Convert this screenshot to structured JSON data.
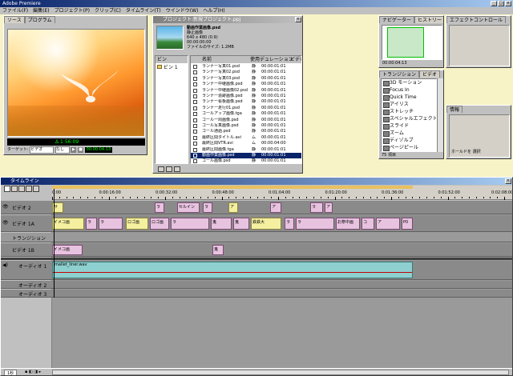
{
  "app": {
    "title": "Adobe Premiere"
  },
  "menu": [
    "ファイル(F)",
    "編集(E)",
    "プロジェクト(P)",
    "クリップ(C)",
    "タイムライン(T)",
    "ウインドウ(W)",
    "ヘルプ(H)"
  ],
  "monitor": {
    "tabs": [
      "ソース",
      "プログラム"
    ],
    "timecode": "Δ 1:56:09",
    "duration": "00:00:04:13",
    "target_label": "ターゲット:",
    "target_value": "ビデオ",
    "none_label": "なし"
  },
  "project": {
    "title": "プロジェクト:新規プロジェクト.ppj",
    "preview": {
      "name": "動画作業画像.psd",
      "type": "静止画像",
      "dims": "640 x 480 (0.9)",
      "duration": "00:00:00:00",
      "size": "ファイルのサイズ: 1.2MB"
    },
    "bin_header": "ビン",
    "bin_name": "ビン 1",
    "columns": [
      "名前",
      "使用",
      "デュレーション",
      "ビデオ"
    ],
    "rows": [
      {
        "name": "ランナー写真01.psd",
        "use": "静",
        "dur": "00:00:01:01"
      },
      {
        "name": "ランナー写真02.psd",
        "use": "静",
        "dur": "00:00:01:01"
      },
      {
        "name": "ランナー写真03.psd",
        "use": "静",
        "dur": "00:00:01:01"
      },
      {
        "name": "ランナー中継画像.psd",
        "use": "静",
        "dur": "00:00:01:01"
      },
      {
        "name": "ランナー中継画像02.psd",
        "use": "静",
        "dur": "00:00:01:01"
      },
      {
        "name": "ランナー追跡画像.psd",
        "use": "静",
        "dur": "00:00:01:01"
      },
      {
        "name": "ランナー看板画像.psd",
        "use": "静",
        "dur": "00:00:01:01"
      },
      {
        "name": "ランナー走行01.psd",
        "use": "静",
        "dur": "00:00:01:01"
      },
      {
        "name": "ゴールアップ画像.tga",
        "use": "静",
        "dur": "00:00:01:01"
      },
      {
        "name": "ゴール一周画像.psd",
        "use": "静",
        "dur": "00:00:01:01"
      },
      {
        "name": "ゴール写真画像.psd",
        "use": "静",
        "dur": "00:00:01:01"
      },
      {
        "name": "ゴール通過.psd",
        "use": "静",
        "dur": "00:00:01:01"
      },
      {
        "name": "最終区間タイトル.avi",
        "use": "ム",
        "dur": "00:00:01:01"
      },
      {
        "name": "最終区間VTR.avi",
        "use": "ム",
        "dur": "00:00:04:00"
      },
      {
        "name": "最終区間画像.tga",
        "use": "静",
        "dur": "00:00:01:01"
      },
      {
        "name": "動画作業画像.psd",
        "use": "静",
        "dur": "00:00:01:01",
        "selected": true
      },
      {
        "name": "ゴール画像.psd",
        "use": "静",
        "dur": "00:00:01:01"
      }
    ]
  },
  "navigator": {
    "tabs": [
      "ナビゲーター",
      "ヒストリー",
      "インフォ"
    ],
    "timecode": "00:00:04:13"
  },
  "commands": {
    "tabs": [
      "エフェクトコントロール"
    ]
  },
  "transitions": {
    "tabs": [
      "トランジション",
      "ビデオ",
      "オーディオ"
    ],
    "items": [
      "3D モーション",
      "Focus In",
      "Quick Time",
      "アイリス",
      "ストレッチ",
      "スペシャルエフェクト",
      "スライド",
      "ズーム",
      "ディゾルブ",
      "ページピール",
      "マップ",
      "ワイプ"
    ],
    "footer": "75 項目"
  },
  "info": {
    "tabs": [
      "情報"
    ],
    "label": "ホールドを 選択"
  },
  "timeline": {
    "title": "タイムライン",
    "ruler": [
      "0:00",
      "0:00:16:00",
      "0:00:32:00",
      "0:00:48:00",
      "0:01:04:00",
      "0:01:20:00",
      "0:01:36:00",
      "0:01:52:00",
      "0:02:08:00"
    ],
    "tracks": {
      "video2": "ビデオ 2",
      "video1a": "ビデオ 1A",
      "transition": "トランジション",
      "video1b": "ビデオ 1B",
      "audio1": "オーディオ 1",
      "audio2": "オーディオ 2",
      "audio3": "オーディオ 3"
    },
    "audio_clip": "mallet_liner.wav",
    "clips_v1a": [
      {
        "label": "イメコ画",
        "yellow": true
      },
      {
        "label": "ラ"
      },
      {
        "label": "ラ"
      },
      {
        "label": "ロゴ画",
        "yellow": true
      },
      {
        "label": "ロゴ画"
      },
      {
        "label": "ラ"
      },
      {
        "label": "鬼"
      },
      {
        "label": "鬼"
      },
      {
        "label": "鉄鉄大",
        "yellow": true
      },
      {
        "label": "ラ"
      },
      {
        "label": "ラ"
      },
      {
        "label": "お祭中画"
      },
      {
        "label": "コ"
      },
      {
        "label": "ア"
      },
      {
        "label": "P0"
      }
    ],
    "clips_v2": [
      {
        "label": "サ",
        "yellow": true
      },
      {
        "label": "ラ"
      },
      {
        "label": "セルイン"
      },
      {
        "label": "ラ"
      },
      {
        "label": "ア",
        "yellow": true
      },
      {
        "label": "ア"
      },
      {
        "label": "ラ"
      },
      {
        "label": "ア"
      }
    ],
    "clips_v1b": [
      {
        "label": "イメコ画"
      },
      {
        "label": "鬼"
      }
    ],
    "footer_left": "1秒",
    "footer_icons": "▪ ◧ ◨ ▸"
  },
  "colors": {
    "desktop": "#f7f3c6",
    "clip": "#e8c3e0",
    "clip_yellow": "#f5f0a0",
    "audio": "#8ecfcf",
    "titlebar": "#0a246a"
  }
}
